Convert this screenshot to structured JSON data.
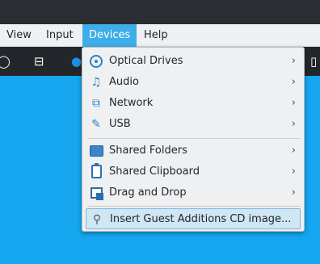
{
  "menubar": {
    "items": [
      {
        "label": "View"
      },
      {
        "label": "Input"
      },
      {
        "label": "Devices"
      },
      {
        "label": "Help"
      }
    ]
  },
  "devices_menu": {
    "items": [
      {
        "label": "Optical Drives",
        "icon": "optical-drive-icon",
        "submenu": true
      },
      {
        "label": "Audio",
        "icon": "audio-icon",
        "submenu": true
      },
      {
        "label": "Network",
        "icon": "network-icon",
        "submenu": true
      },
      {
        "label": "USB",
        "icon": "usb-icon",
        "submenu": true
      },
      {
        "label": "Shared Folders",
        "icon": "shared-folders-icon",
        "submenu": true
      },
      {
        "label": "Shared Clipboard",
        "icon": "clipboard-icon",
        "submenu": true
      },
      {
        "label": "Drag and Drop",
        "icon": "drag-drop-icon",
        "submenu": true
      },
      {
        "label": "Insert Guest Additions CD image...",
        "icon": "guest-additions-icon",
        "submenu": false,
        "highlighted": true
      }
    ],
    "submenu_arrow": "›"
  },
  "colors": {
    "menu_highlight": "#3daee9",
    "vm_background": "#15a6ef",
    "menu_background": "#eff0f1"
  }
}
